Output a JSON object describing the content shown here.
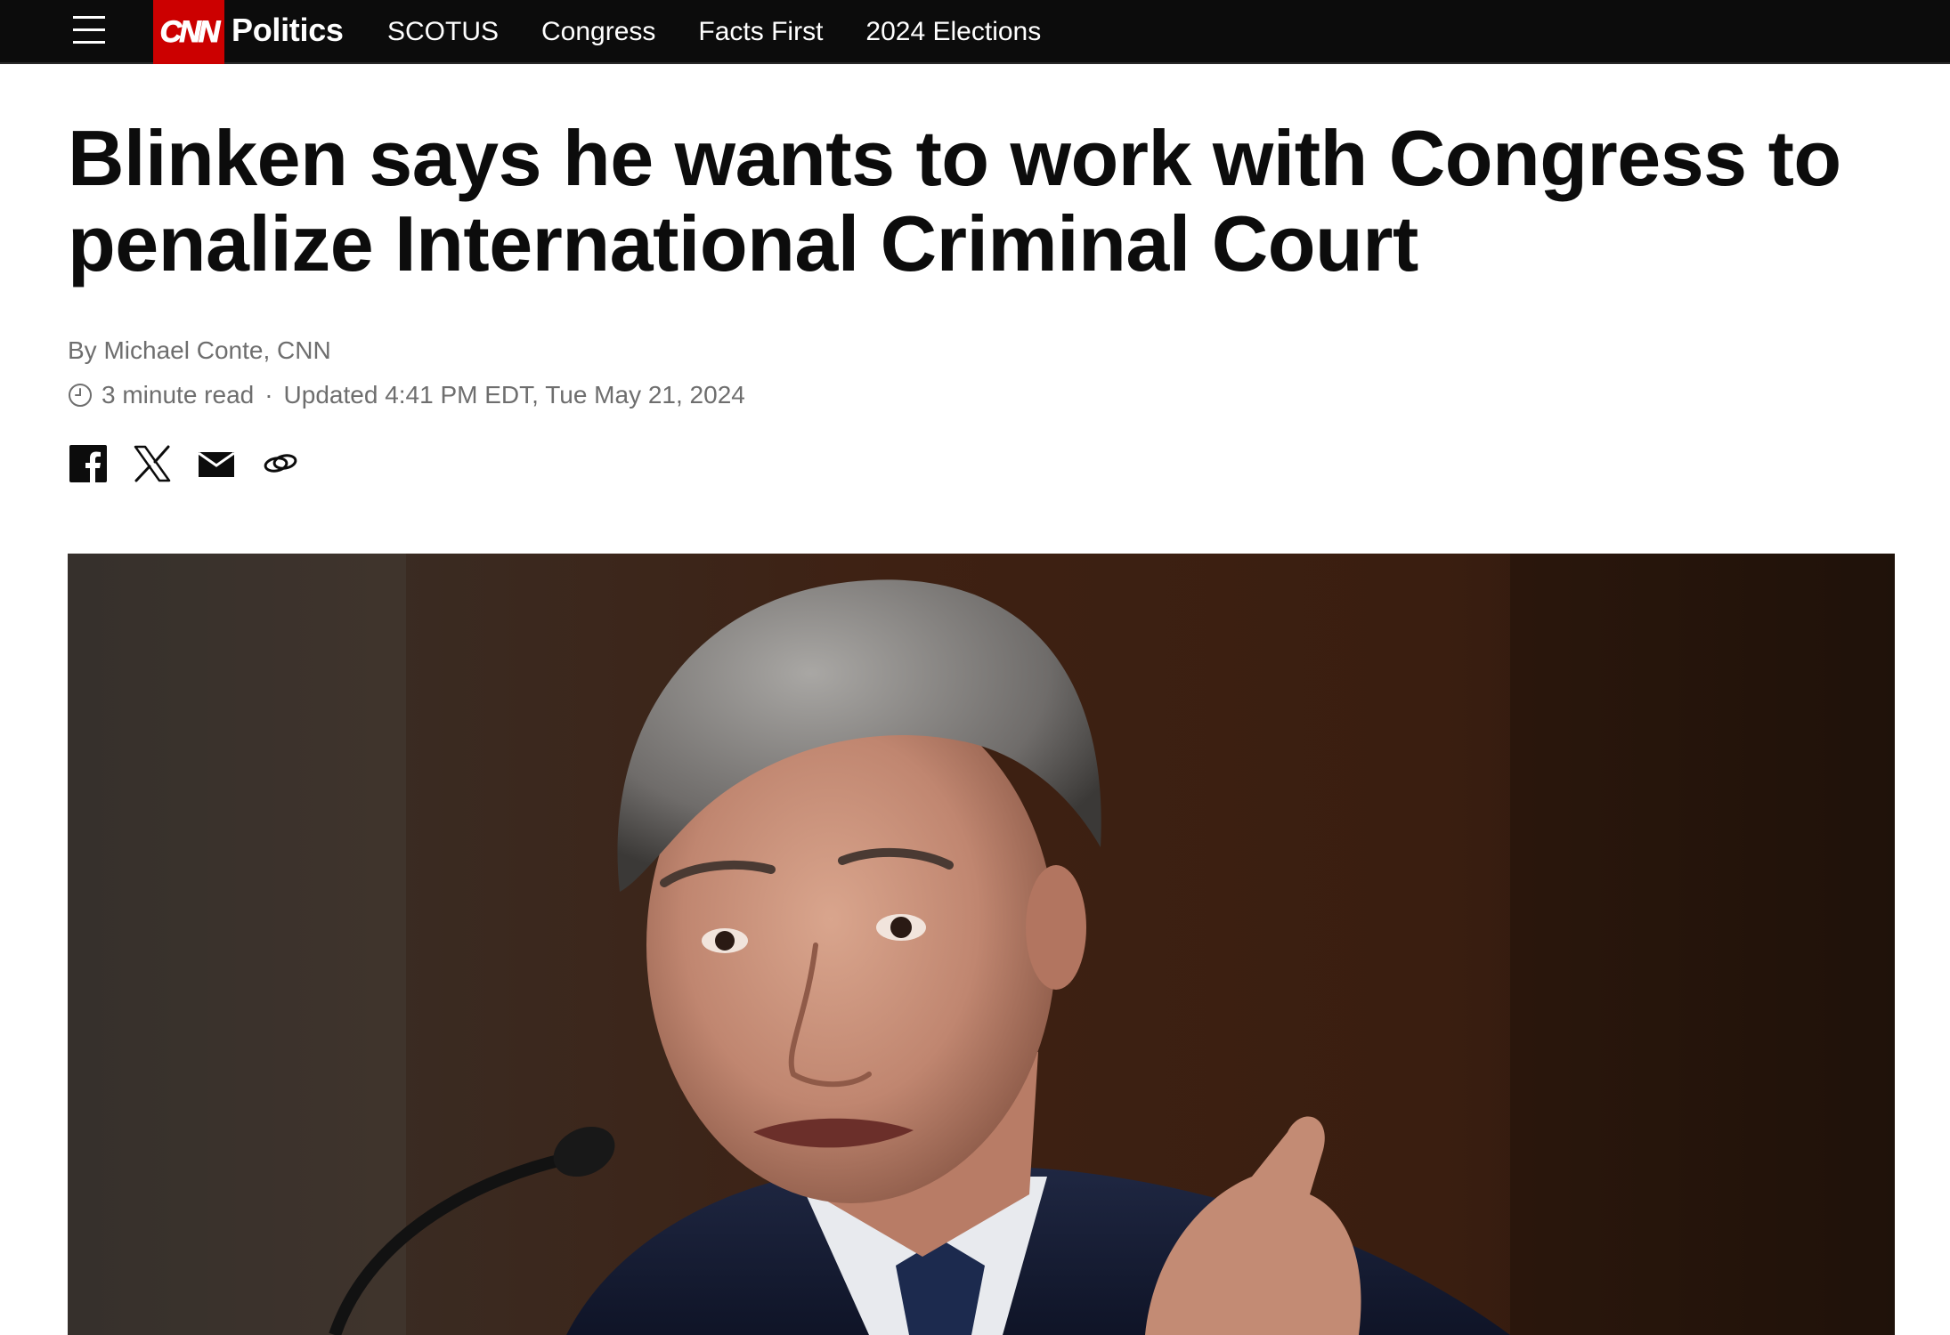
{
  "nav": {
    "logo_text": "CNN",
    "section": "Politics",
    "links": [
      "SCOTUS",
      "Congress",
      "Facts First",
      "2024 Elections"
    ]
  },
  "article": {
    "headline": "Blinken says he wants to work with Congress to penalize International Criminal Court",
    "byline_prefix": "By ",
    "author": "Michael Conte, CNN",
    "read_time": "3 minute read",
    "separator": "·",
    "updated": "Updated 4:41 PM EDT, Tue May 21, 2024"
  },
  "share": {
    "icons": [
      "facebook-icon",
      "x-icon",
      "email-icon",
      "link-icon"
    ]
  },
  "colors": {
    "nav_background": "#0c0c0c",
    "brand_red": "#cc0000",
    "meta_text": "#6e6e6e"
  }
}
